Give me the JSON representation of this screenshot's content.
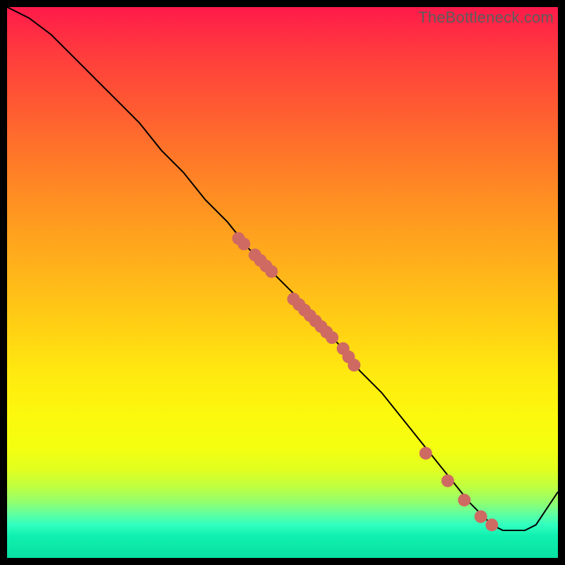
{
  "watermark": "TheBottleneck.com",
  "colors": {
    "dot": "#cf6a62",
    "line": "#000000"
  },
  "chart_data": {
    "type": "line",
    "title": "",
    "xlabel": "",
    "ylabel": "",
    "xlim": [
      0,
      100
    ],
    "ylim": [
      0,
      100
    ],
    "series": [
      {
        "name": "curve",
        "x": [
          0,
          4,
          8,
          12,
          16,
          20,
          24,
          28,
          32,
          36,
          40,
          44,
          48,
          52,
          56,
          60,
          64,
          68,
          72,
          76,
          80,
          84,
          88,
          90,
          92,
          94,
          96,
          100
        ],
        "y": [
          100,
          98,
          95,
          91,
          87,
          83,
          79,
          74,
          70,
          65,
          61,
          56,
          52,
          48,
          43,
          39,
          34,
          30,
          25,
          20,
          15,
          10,
          6,
          5,
          5,
          5,
          6,
          12
        ]
      }
    ],
    "scatter_points": {
      "name": "highlighted",
      "x": [
        42,
        43,
        45,
        46,
        47,
        48,
        52,
        53,
        54,
        55,
        56,
        57,
        58,
        59,
        61,
        62,
        63,
        76,
        80,
        83,
        86,
        88
      ],
      "y": [
        58,
        57,
        55,
        54,
        53,
        52,
        47,
        46,
        45,
        44,
        43,
        42,
        41,
        40,
        38,
        36.5,
        35,
        19,
        14,
        10.5,
        7.5,
        6
      ]
    }
  }
}
